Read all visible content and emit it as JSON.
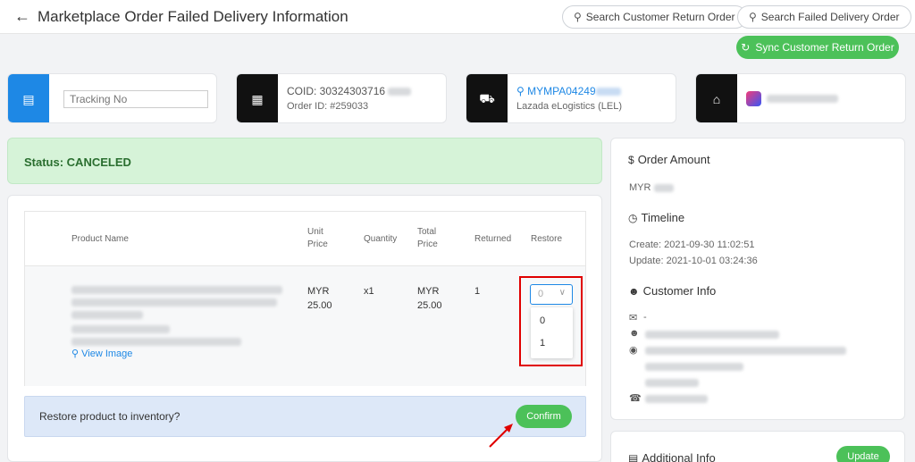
{
  "header": {
    "title": "Marketplace Order Failed Delivery Information",
    "search_return_label": "Search Customer Return Order",
    "search_failed_label": "Search Failed Delivery Order",
    "sync_label": "Sync Customer Return Order"
  },
  "cards": {
    "tracking_placeholder": "Tracking No",
    "coid": "COID: 30324303716",
    "order_id": "Order ID: #259033",
    "tracking_code": "MYMPA04249",
    "courier": "Lazada eLogistics (LEL)"
  },
  "status": {
    "text": "Status: CANCELED"
  },
  "table": {
    "headers": {
      "product_name": "Product Name",
      "unit_price": [
        "Unit",
        "Price"
      ],
      "quantity": "Quantity",
      "total_price": [
        "Total",
        "Price"
      ],
      "returned": "Returned",
      "restore": "Restore"
    },
    "row": {
      "unit_price": [
        "MYR",
        "25.00"
      ],
      "quantity": "x1",
      "total_price": [
        "MYR",
        "25.00"
      ],
      "returned": "1",
      "restore_value": "0",
      "view_image": "View Image"
    },
    "restore_options": [
      "0",
      "1"
    ]
  },
  "restore_bar": {
    "question": "Restore product to inventory?",
    "confirm_label": "Confirm"
  },
  "side": {
    "order_amount_title": "Order Amount",
    "currency": "MYR",
    "timeline_title": "Timeline",
    "create": "Create: 2021-09-30 11:02:51",
    "update": "Update: 2021-10-01 03:24:36",
    "customer_title": "Customer Info",
    "email": "-",
    "additional_title": "Additional Info",
    "update_label": "Update"
  },
  "colors": {
    "accent": "#1e88e5",
    "success": "#4cc159",
    "highlight": "#e00000"
  }
}
